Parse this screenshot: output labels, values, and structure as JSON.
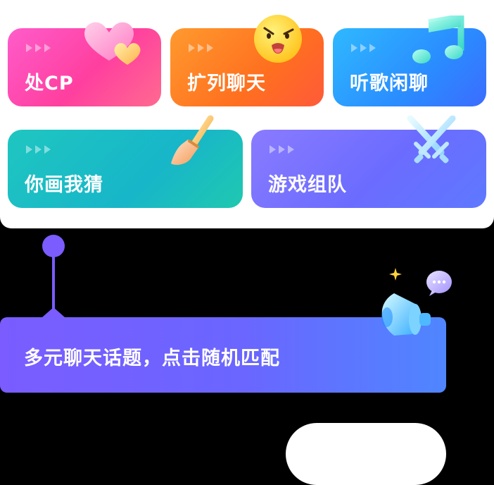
{
  "categories": [
    {
      "label": "处CP",
      "icon": "heart-icon"
    },
    {
      "label": "扩列聊天",
      "icon": "emoji-face-icon"
    },
    {
      "label": "听歌闲聊",
      "icon": "music-note-icon"
    },
    {
      "label": "你画我猜",
      "icon": "paintbrush-icon"
    },
    {
      "label": "游戏组队",
      "icon": "crossed-swords-icon"
    }
  ],
  "banner": {
    "text": "多元聊天话题，点击随机匹配",
    "icon": "megaphone-icon"
  },
  "button": {
    "label": ""
  },
  "colors": {
    "card_pink": "#ff4fb0",
    "card_orange": "#ff7a25",
    "card_blue": "#2a8cff",
    "card_teal": "#1bbfc4",
    "card_purple": "#7070ff",
    "accent": "#7a5cff"
  }
}
